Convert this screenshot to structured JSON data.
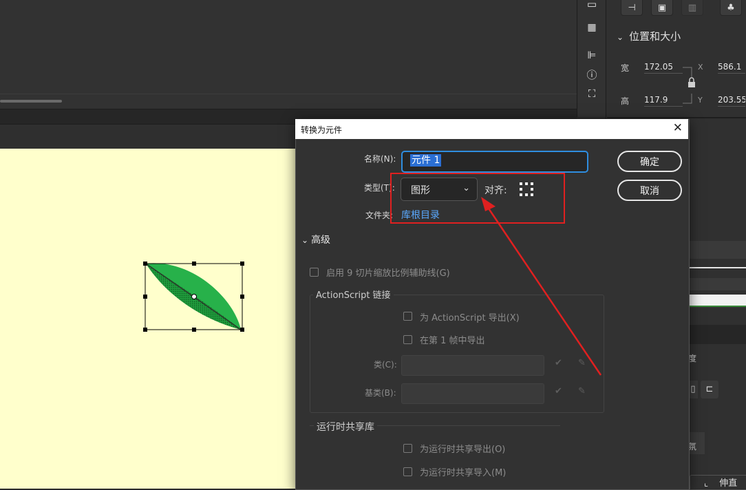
{
  "properties": {
    "section_title": "位置和大小",
    "width_label": "宽",
    "height_label": "高",
    "width_value": "172.05",
    "height_value": "117.9",
    "x_label": "X",
    "y_label": "Y",
    "x_value": "586.1",
    "y_value": "203.55",
    "partial_text_1": "度",
    "partial_text_2": "氛",
    "partial_text_3": "伸直"
  },
  "dialog": {
    "title": "转换为元件",
    "name_label": "名称(N):",
    "name_value": "元件 1",
    "type_label": "类型(T):",
    "type_value": "图形",
    "align_label": "对齐:",
    "folder_label": "文件夹:",
    "folder_value": "库根目录",
    "ok_label": "确定",
    "cancel_label": "取消",
    "advanced_label": "高级",
    "nine_slice_label": "启用 9 切片缩放比例辅助线(G)",
    "actionscript_group": "ActionScript 链接",
    "export_as_label": "为 ActionScript 导出(X)",
    "export_frame_label": "在第 1 帧中导出",
    "class_label": "类(C):",
    "base_class_label": "基类(B):",
    "runtime_group": "运行时共享库",
    "runtime_export_label": "为运行时共享导出(O)",
    "runtime_import_label": "为运行时共享导入(M)"
  },
  "colors": {
    "accent_blue": "#2f8ee0",
    "link_blue": "#5aa9ff",
    "callout_red": "#e02020",
    "stage_bg": "#ffffcc",
    "leaf_green": "#27b14a"
  }
}
